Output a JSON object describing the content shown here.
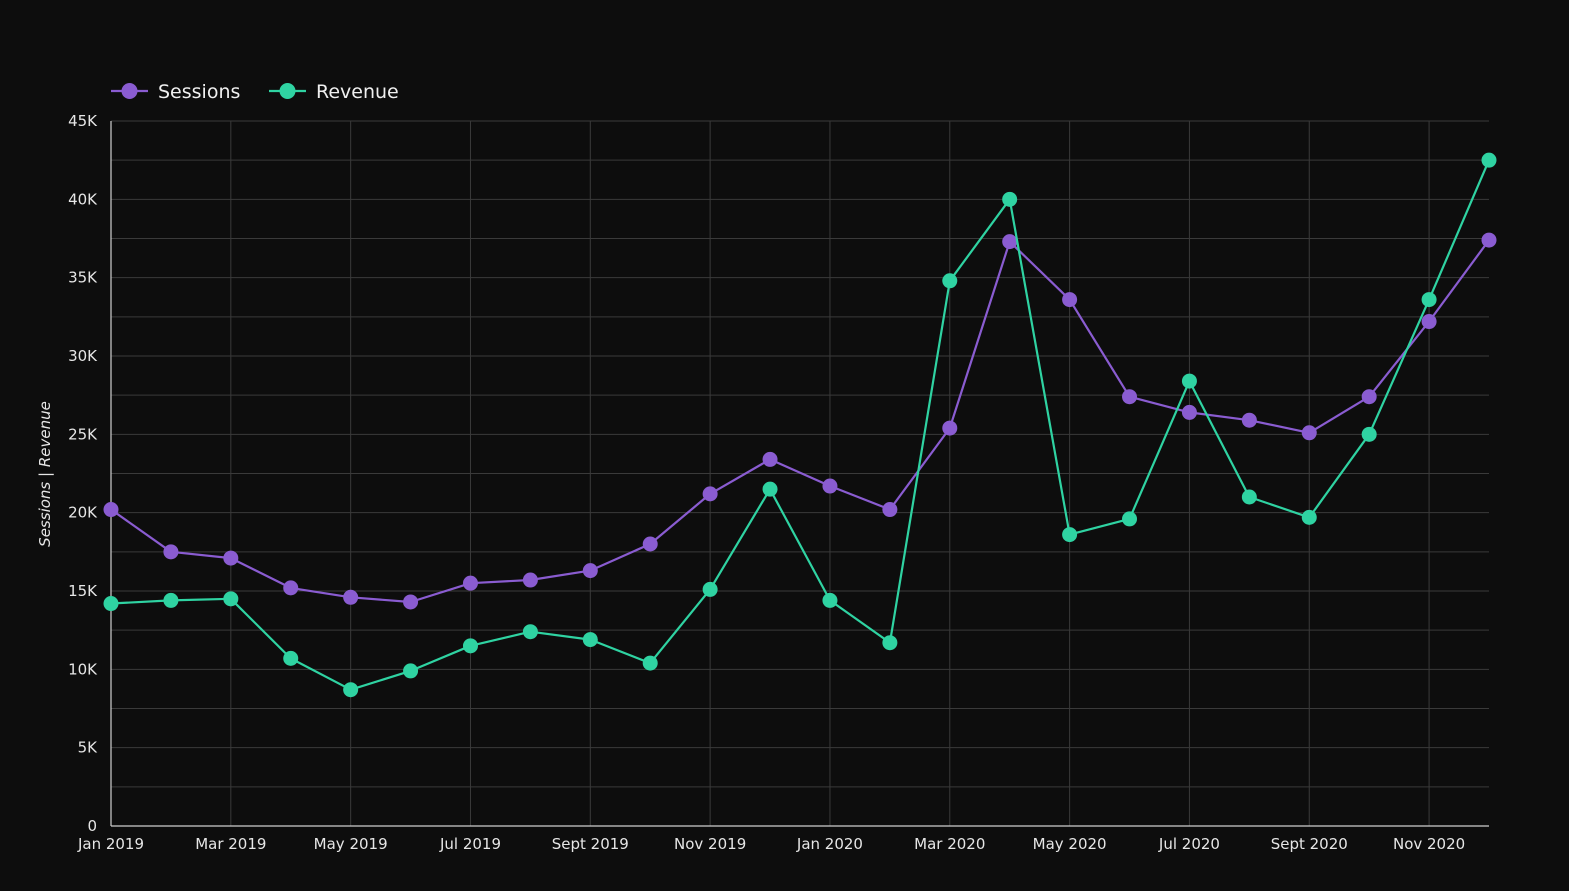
{
  "chart_data": {
    "type": "line",
    "x": [
      "Jan 2019",
      "Feb 2019",
      "Mar 2019",
      "Apr 2019",
      "May 2019",
      "Jun 2019",
      "Jul 2019",
      "Aug 2019",
      "Sept 2019",
      "Oct 2019",
      "Nov 2019",
      "Dec 2019",
      "Jan 2020",
      "Feb 2020",
      "Mar 2020",
      "Apr 2020",
      "May 2020",
      "Jun 2020",
      "Jul 2020",
      "Aug 2020",
      "Sept 2020",
      "Oct 2020",
      "Nov 2020",
      "Dec 2020"
    ],
    "x_tick_labels": [
      "Jan 2019",
      "Mar 2019",
      "May 2019",
      "Jul 2019",
      "Sept 2019",
      "Nov 2019",
      "Jan 2020",
      "Mar 2020",
      "May 2020",
      "Jul 2020",
      "Sept 2020",
      "Nov 2020"
    ],
    "series": [
      {
        "name": "Sessions",
        "color": "#8a5cd1",
        "values": [
          20200,
          17500,
          17100,
          15200,
          14600,
          14300,
          15500,
          15700,
          16300,
          18000,
          21200,
          23400,
          21700,
          20200,
          25400,
          37300,
          33600,
          27400,
          26400,
          25900,
          25100,
          27400,
          32200,
          37400
        ]
      },
      {
        "name": "Revenue",
        "color": "#2fd3a2",
        "values": [
          14200,
          14400,
          14500,
          10700,
          8700,
          9900,
          11500,
          12400,
          11900,
          10400,
          15100,
          21500,
          14400,
          11700,
          34800,
          40000,
          18600,
          19600,
          28400,
          21000,
          19700,
          25000,
          33600,
          42500
        ]
      }
    ],
    "y_ticks": [
      "0",
      "5K",
      "10K",
      "15K",
      "20K",
      "25K",
      "30K",
      "35K",
      "40K",
      "45K"
    ],
    "ylim": [
      0,
      45000
    ],
    "ylabel": "Sessions | Revenue",
    "legend_position": "top-left",
    "grid": true
  },
  "colors": {
    "background": "#0d0d0d",
    "grid": "#3a3a3a",
    "axis": "#cfcfcf",
    "text": "#e6e6e6"
  }
}
